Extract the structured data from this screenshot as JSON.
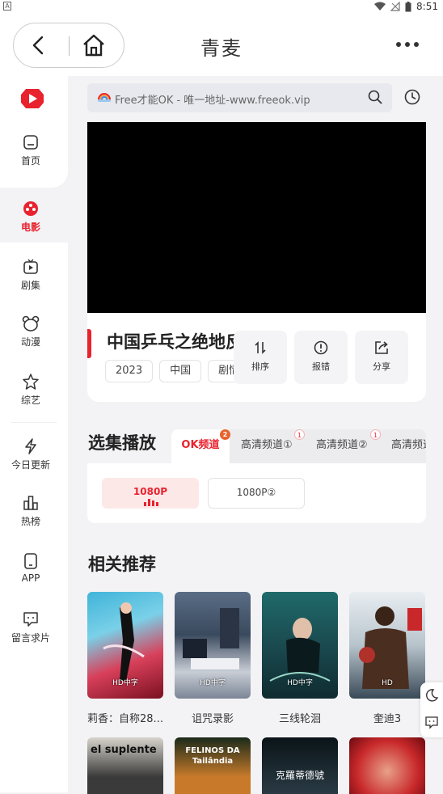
{
  "status_bar": {
    "time": "8:51",
    "left_badge": "A"
  },
  "header": {
    "title": "青麦"
  },
  "sidebar": {
    "items": [
      {
        "label": "首页",
        "icon": "home-icon"
      },
      {
        "label": "电影",
        "icon": "film-icon",
        "active": true
      },
      {
        "label": "剧集",
        "icon": "tv-icon"
      },
      {
        "label": "动漫",
        "icon": "bear-icon"
      },
      {
        "label": "综艺",
        "icon": "star-icon"
      },
      {
        "label": "今日更新",
        "icon": "lightning-icon"
      },
      {
        "label": "热榜",
        "icon": "chart-icon"
      },
      {
        "label": "APP",
        "icon": "phone-icon"
      },
      {
        "label": "留言求片",
        "icon": "message-icon"
      }
    ]
  },
  "search": {
    "placeholder": "Free才能OK - 唯一地址-www.freeok.vip"
  },
  "movie": {
    "title": "中国乒乓之绝地反击",
    "tags": [
      "2023",
      "中国",
      "剧情 /"
    ]
  },
  "actions": [
    {
      "label": "排序",
      "icon": "sort-icon"
    },
    {
      "label": "报错",
      "icon": "alert-icon"
    },
    {
      "label": "分享",
      "icon": "share-icon"
    }
  ],
  "episodes_section": {
    "title": "选集播放",
    "tabs": [
      {
        "label": "OK频道",
        "badge": "2",
        "active": true
      },
      {
        "label": "高清频道①",
        "badge": "1"
      },
      {
        "label": "高清频道②",
        "badge": "1"
      },
      {
        "label": "高清频道"
      }
    ],
    "episodes": [
      {
        "label": "1080P",
        "active": true
      },
      {
        "label": "1080P②"
      }
    ]
  },
  "recommend": {
    "title": "相关推荐",
    "items": [
      {
        "name": "莉香：自称28...",
        "badge": "HD中字"
      },
      {
        "name": "诅咒录影",
        "badge": "HD中字"
      },
      {
        "name": "三线轮洄",
        "badge": "HD中字"
      },
      {
        "name": "奎迪3",
        "badge": "HD"
      }
    ],
    "row2_texts": [
      "el suplente",
      "FELINOS DA Tailândia",
      "克羅蒂德號"
    ]
  },
  "colors": {
    "accent": "#e8232e",
    "background": "#f3f3f5"
  }
}
